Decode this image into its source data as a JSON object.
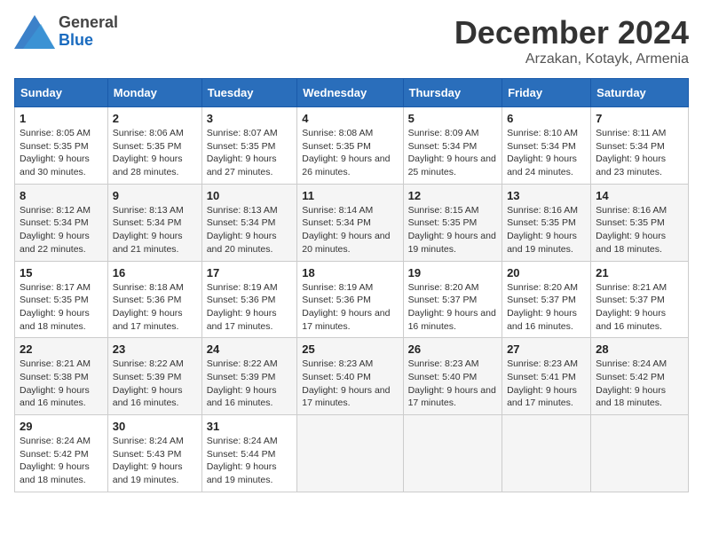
{
  "header": {
    "logo_general": "General",
    "logo_blue": "Blue",
    "month_title": "December 2024",
    "location": "Arzakan, Kotayk, Armenia"
  },
  "days_of_week": [
    "Sunday",
    "Monday",
    "Tuesday",
    "Wednesday",
    "Thursday",
    "Friday",
    "Saturday"
  ],
  "weeks": [
    [
      {
        "day": "1",
        "sunrise": "8:05 AM",
        "sunset": "5:35 PM",
        "daylight": "9 hours and 30 minutes."
      },
      {
        "day": "2",
        "sunrise": "8:06 AM",
        "sunset": "5:35 PM",
        "daylight": "9 hours and 28 minutes."
      },
      {
        "day": "3",
        "sunrise": "8:07 AM",
        "sunset": "5:35 PM",
        "daylight": "9 hours and 27 minutes."
      },
      {
        "day": "4",
        "sunrise": "8:08 AM",
        "sunset": "5:35 PM",
        "daylight": "9 hours and 26 minutes."
      },
      {
        "day": "5",
        "sunrise": "8:09 AM",
        "sunset": "5:34 PM",
        "daylight": "9 hours and 25 minutes."
      },
      {
        "day": "6",
        "sunrise": "8:10 AM",
        "sunset": "5:34 PM",
        "daylight": "9 hours and 24 minutes."
      },
      {
        "day": "7",
        "sunrise": "8:11 AM",
        "sunset": "5:34 PM",
        "daylight": "9 hours and 23 minutes."
      }
    ],
    [
      {
        "day": "8",
        "sunrise": "8:12 AM",
        "sunset": "5:34 PM",
        "daylight": "9 hours and 22 minutes."
      },
      {
        "day": "9",
        "sunrise": "8:13 AM",
        "sunset": "5:34 PM",
        "daylight": "9 hours and 21 minutes."
      },
      {
        "day": "10",
        "sunrise": "8:13 AM",
        "sunset": "5:34 PM",
        "daylight": "9 hours and 20 minutes."
      },
      {
        "day": "11",
        "sunrise": "8:14 AM",
        "sunset": "5:34 PM",
        "daylight": "9 hours and 20 minutes."
      },
      {
        "day": "12",
        "sunrise": "8:15 AM",
        "sunset": "5:35 PM",
        "daylight": "9 hours and 19 minutes."
      },
      {
        "day": "13",
        "sunrise": "8:16 AM",
        "sunset": "5:35 PM",
        "daylight": "9 hours and 19 minutes."
      },
      {
        "day": "14",
        "sunrise": "8:16 AM",
        "sunset": "5:35 PM",
        "daylight": "9 hours and 18 minutes."
      }
    ],
    [
      {
        "day": "15",
        "sunrise": "8:17 AM",
        "sunset": "5:35 PM",
        "daylight": "9 hours and 18 minutes."
      },
      {
        "day": "16",
        "sunrise": "8:18 AM",
        "sunset": "5:36 PM",
        "daylight": "9 hours and 17 minutes."
      },
      {
        "day": "17",
        "sunrise": "8:19 AM",
        "sunset": "5:36 PM",
        "daylight": "9 hours and 17 minutes."
      },
      {
        "day": "18",
        "sunrise": "8:19 AM",
        "sunset": "5:36 PM",
        "daylight": "9 hours and 17 minutes."
      },
      {
        "day": "19",
        "sunrise": "8:20 AM",
        "sunset": "5:37 PM",
        "daylight": "9 hours and 16 minutes."
      },
      {
        "day": "20",
        "sunrise": "8:20 AM",
        "sunset": "5:37 PM",
        "daylight": "9 hours and 16 minutes."
      },
      {
        "day": "21",
        "sunrise": "8:21 AM",
        "sunset": "5:37 PM",
        "daylight": "9 hours and 16 minutes."
      }
    ],
    [
      {
        "day": "22",
        "sunrise": "8:21 AM",
        "sunset": "5:38 PM",
        "daylight": "9 hours and 16 minutes."
      },
      {
        "day": "23",
        "sunrise": "8:22 AM",
        "sunset": "5:39 PM",
        "daylight": "9 hours and 16 minutes."
      },
      {
        "day": "24",
        "sunrise": "8:22 AM",
        "sunset": "5:39 PM",
        "daylight": "9 hours and 16 minutes."
      },
      {
        "day": "25",
        "sunrise": "8:23 AM",
        "sunset": "5:40 PM",
        "daylight": "9 hours and 17 minutes."
      },
      {
        "day": "26",
        "sunrise": "8:23 AM",
        "sunset": "5:40 PM",
        "daylight": "9 hours and 17 minutes."
      },
      {
        "day": "27",
        "sunrise": "8:23 AM",
        "sunset": "5:41 PM",
        "daylight": "9 hours and 17 minutes."
      },
      {
        "day": "28",
        "sunrise": "8:24 AM",
        "sunset": "5:42 PM",
        "daylight": "9 hours and 18 minutes."
      }
    ],
    [
      {
        "day": "29",
        "sunrise": "8:24 AM",
        "sunset": "5:42 PM",
        "daylight": "9 hours and 18 minutes."
      },
      {
        "day": "30",
        "sunrise": "8:24 AM",
        "sunset": "5:43 PM",
        "daylight": "9 hours and 19 minutes."
      },
      {
        "day": "31",
        "sunrise": "8:24 AM",
        "sunset": "5:44 PM",
        "daylight": "9 hours and 19 minutes."
      },
      null,
      null,
      null,
      null
    ]
  ],
  "labels": {
    "sunrise": "Sunrise:",
    "sunset": "Sunset:",
    "daylight": "Daylight:"
  }
}
